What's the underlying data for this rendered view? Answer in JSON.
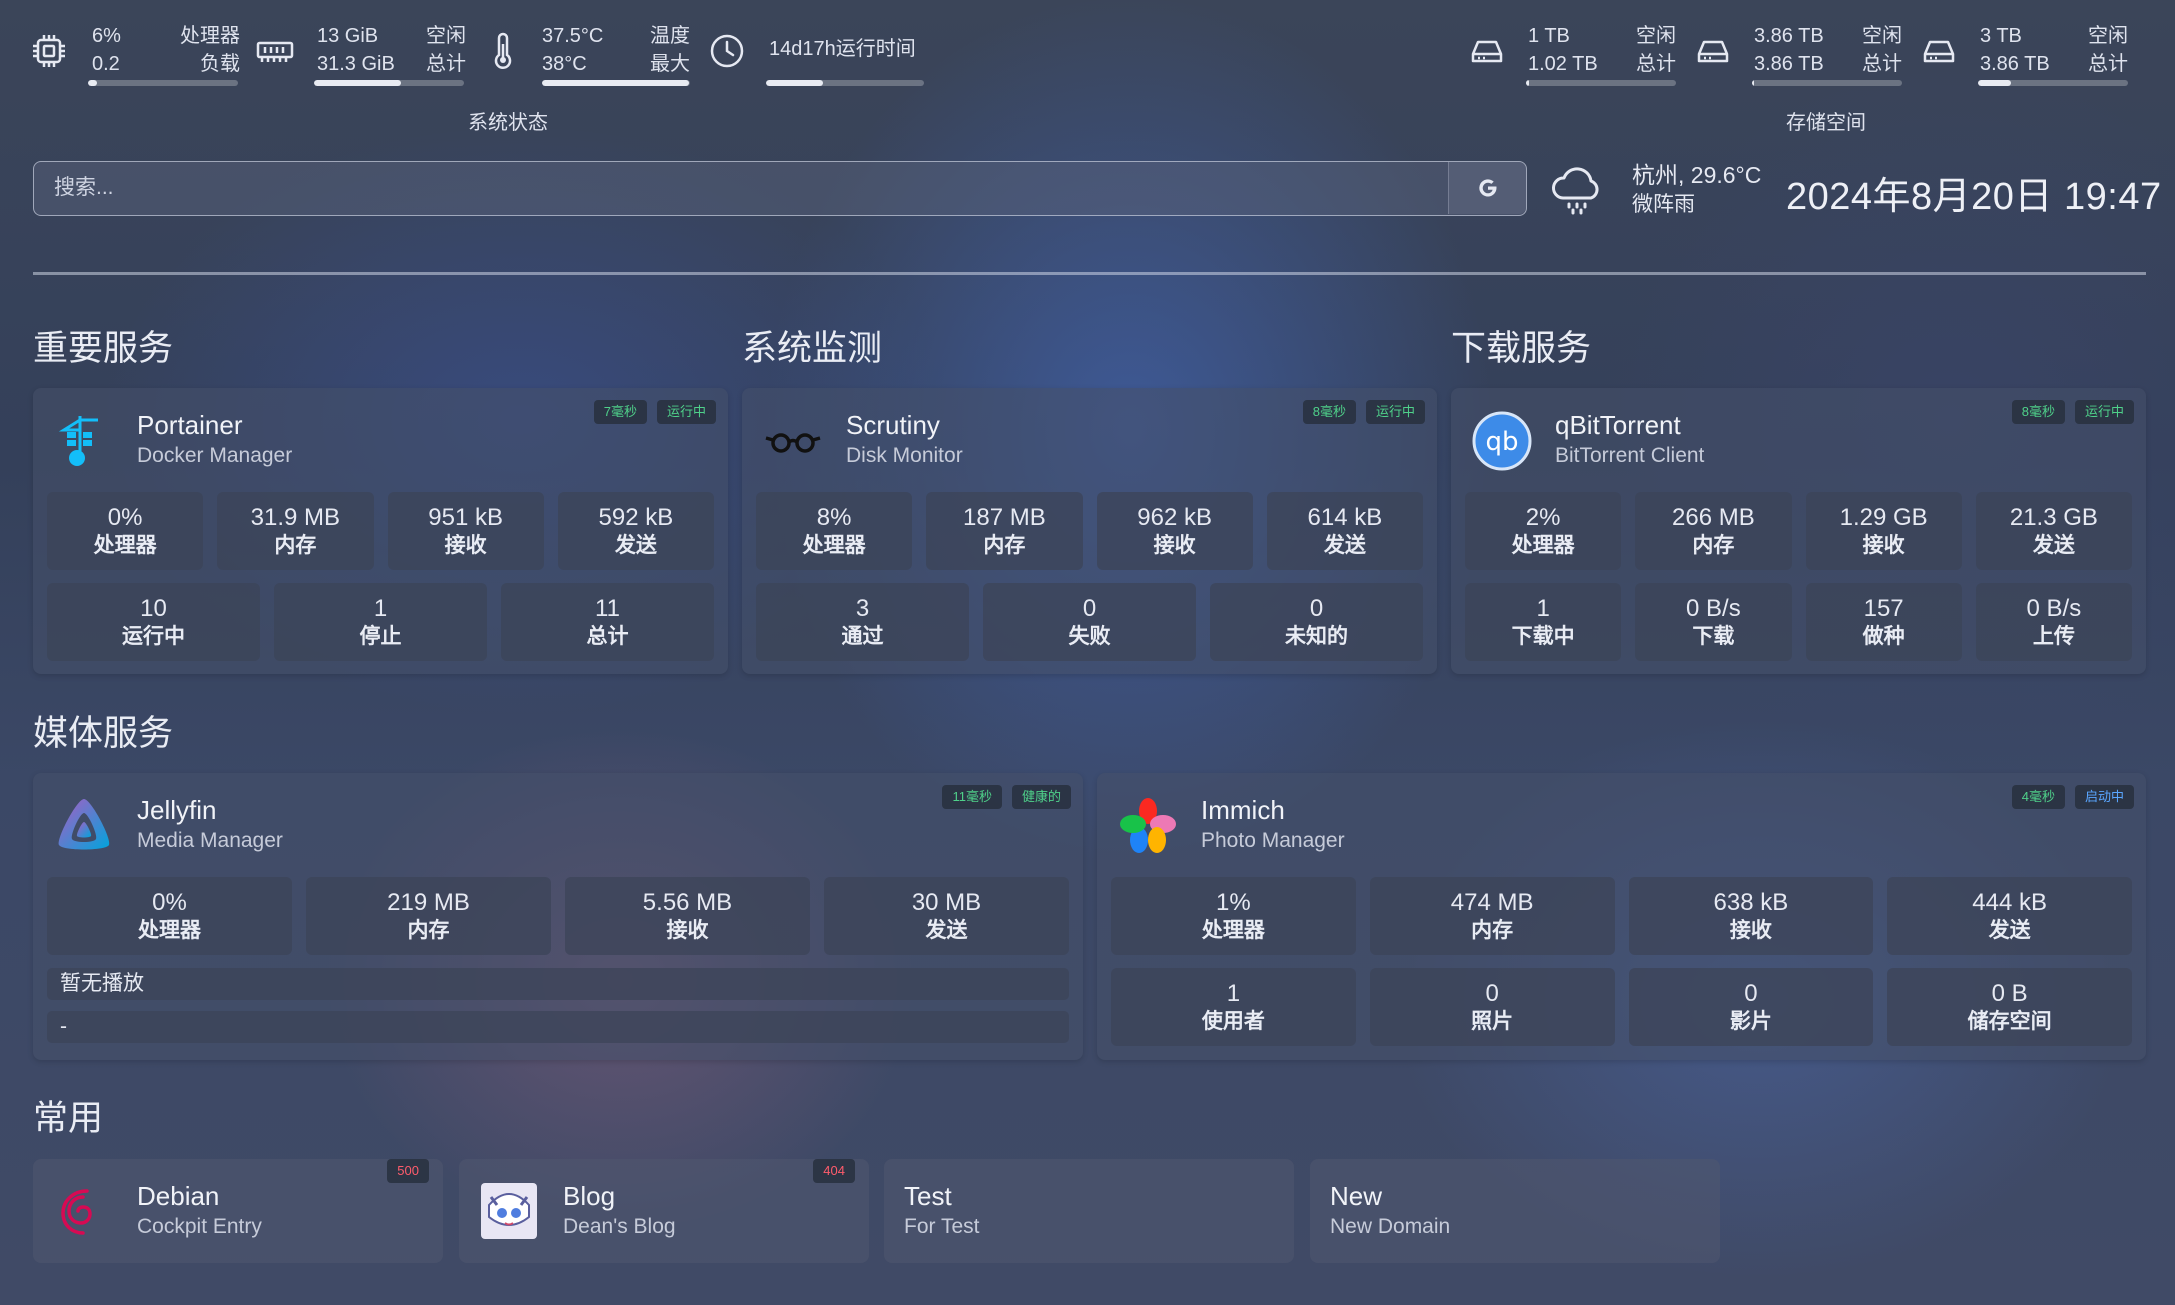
{
  "system": {
    "cpu": {
      "v1": "6%",
      "v2": "0.2",
      "l1": "处理器",
      "l2": "负载",
      "fill": 0.06
    },
    "mem": {
      "v1": "13 GiB",
      "v2": "31.3 GiB",
      "l1": "空闲",
      "l2": "总计",
      "fill": 0.58
    },
    "temp": {
      "v1": "37.5°C",
      "v2": "38°C",
      "l1": "温度",
      "l2": "最大",
      "fill": 0.99
    },
    "uptime": {
      "v1": "14d17h运行时间",
      "fill": 0.36
    },
    "label": "系统状态"
  },
  "storage": {
    "label": "存储空间",
    "disks": [
      {
        "v1": "1 TB",
        "v2": "1.02 TB",
        "l1": "空闲",
        "l2": "总计",
        "fill": 0.02
      },
      {
        "v1": "3.86 TB",
        "v2": "3.86 TB",
        "l1": "空闲",
        "l2": "总计",
        "fill": 0.01
      },
      {
        "v1": "3 TB",
        "v2": "3.86 TB",
        "l1": "空闲",
        "l2": "总计",
        "fill": 0.22
      }
    ]
  },
  "search": {
    "placeholder": "搜索..."
  },
  "weather": {
    "line1": "杭州, 29.6°C",
    "line2": "微阵雨"
  },
  "clock": "2024年8月20日 19:47",
  "sections": {
    "important": "重要服务",
    "monitor": "系统监测",
    "download": "下载服务",
    "media": "媒体服务",
    "common": "常用"
  },
  "cards": {
    "portainer": {
      "name": "Portainer",
      "desc": "Docker Manager",
      "b1": "7毫秒",
      "b2": "运行中",
      "row1": [
        [
          "0%",
          "处理器"
        ],
        [
          "31.9 MB",
          "内存"
        ],
        [
          "951 kB",
          "接收"
        ],
        [
          "592 kB",
          "发送"
        ]
      ],
      "row2": [
        [
          "10",
          "运行中"
        ],
        [
          "1",
          "停止"
        ],
        [
          "11",
          "总计"
        ]
      ]
    },
    "scrutiny": {
      "name": "Scrutiny",
      "desc": "Disk Monitor",
      "b1": "8毫秒",
      "b2": "运行中",
      "row1": [
        [
          "8%",
          "处理器"
        ],
        [
          "187 MB",
          "内存"
        ],
        [
          "962 kB",
          "接收"
        ],
        [
          "614 kB",
          "发送"
        ]
      ],
      "row2": [
        [
          "3",
          "通过"
        ],
        [
          "0",
          "失败"
        ],
        [
          "0",
          "未知的"
        ]
      ]
    },
    "qbit": {
      "name": "qBitTorrent",
      "desc": "BitTorrent Client",
      "b1": "8毫秒",
      "b2": "运行中",
      "row1": [
        [
          "2%",
          "处理器"
        ],
        [
          "266 MB",
          "内存"
        ],
        [
          "1.29 GB",
          "接收"
        ],
        [
          "21.3 GB",
          "发送"
        ]
      ],
      "row2": [
        [
          "1",
          "下载中"
        ],
        [
          "0 B/s",
          "下载"
        ],
        [
          "157",
          "做种"
        ],
        [
          "0 B/s",
          "上传"
        ]
      ]
    },
    "jellyfin": {
      "name": "Jellyfin",
      "desc": "Media Manager",
      "b1": "11毫秒",
      "b2": "健康的",
      "row1": [
        [
          "0%",
          "处理器"
        ],
        [
          "219 MB",
          "内存"
        ],
        [
          "5.56 MB",
          "接收"
        ],
        [
          "30 MB",
          "发送"
        ]
      ],
      "strip1": "暂无播放",
      "strip2": "-"
    },
    "immich": {
      "name": "Immich",
      "desc": "Photo Manager",
      "b1": "4毫秒",
      "b2": "启动中",
      "row1": [
        [
          "1%",
          "处理器"
        ],
        [
          "474 MB",
          "内存"
        ],
        [
          "638 kB",
          "接收"
        ],
        [
          "444 kB",
          "发送"
        ]
      ],
      "row2": [
        [
          "1",
          "使用者"
        ],
        [
          "0",
          "照片"
        ],
        [
          "0",
          "影片"
        ],
        [
          "0 B",
          "储存空间"
        ]
      ]
    }
  },
  "bookmarks": [
    {
      "name": "Debian",
      "desc": "Cockpit Entry",
      "badge": "500"
    },
    {
      "name": "Blog",
      "desc": "Dean's Blog",
      "badge": "404"
    },
    {
      "name": "Test",
      "desc": "For Test"
    },
    {
      "name": "New",
      "desc": "New Domain"
    }
  ]
}
